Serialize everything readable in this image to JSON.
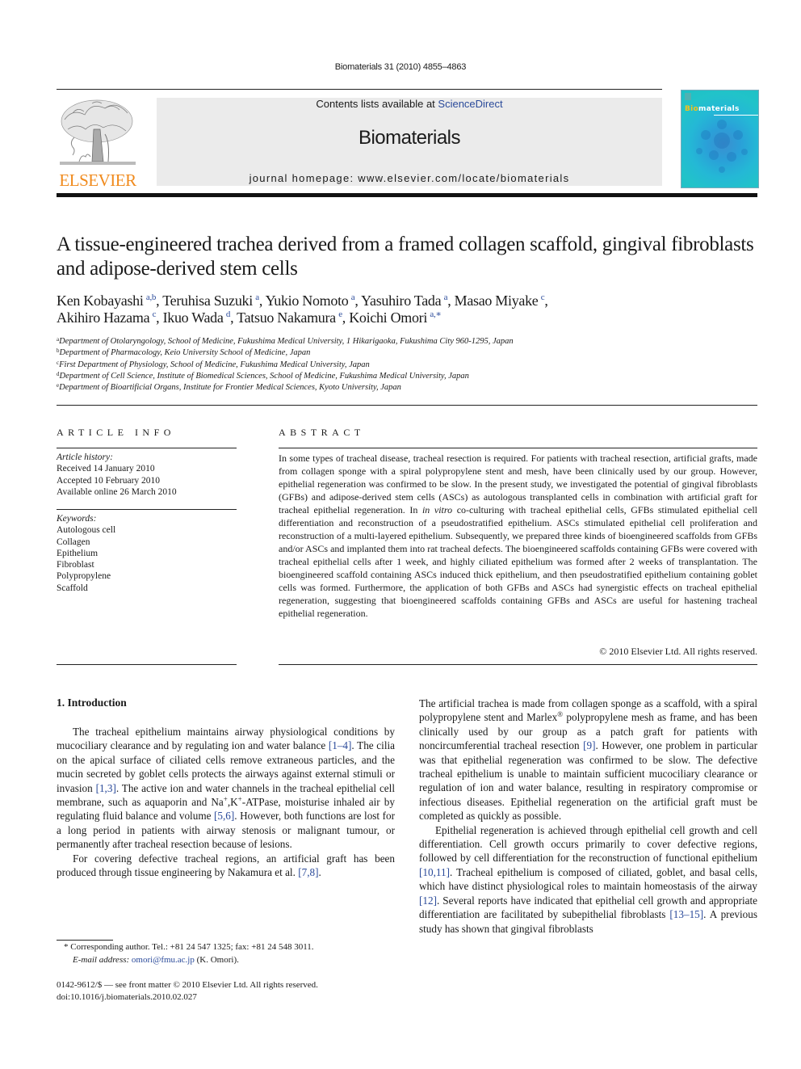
{
  "running_head": "Biomaterials 31 (2010) 4855–4863",
  "masthead": {
    "publisher_logo_text": "ELSEVIER",
    "contents_prefix": "Contents lists available at ",
    "contents_link": "ScienceDirect",
    "journal_name": "Biomaterials",
    "homepage": "journal homepage: www.elsevier.com/locate/biomaterials",
    "cover_title_bio": "Bio",
    "cover_title_rest": "materials",
    "colors": {
      "publisher_orange": "#f08a1c",
      "link_blue": "#2a4a9a",
      "masthead_bg": "#ebebeb",
      "cover_teal": "#21c3c9"
    }
  },
  "article": {
    "title": "A tissue-engineered trachea derived from a framed collagen scaffold, gingival fibroblasts and adipose-derived stem cells",
    "authors": [
      {
        "name": "Ken Kobayashi",
        "aff": "a,b",
        "sep": ", "
      },
      {
        "name": "Teruhisa Suzuki",
        "aff": "a",
        "sep": ", "
      },
      {
        "name": "Yukio Nomoto",
        "aff": "a",
        "sep": ", "
      },
      {
        "name": "Yasuhiro Tada",
        "aff": "a",
        "sep": ", "
      },
      {
        "name": "Masao Miyake",
        "aff": "c",
        "sep": ","
      },
      {
        "name": "Akihiro Hazama",
        "aff": "c",
        "sep": ", "
      },
      {
        "name": "Ikuo Wada",
        "aff": "d",
        "sep": ", "
      },
      {
        "name": "Tatsuo Nakamura",
        "aff": "e",
        "sep": ", "
      },
      {
        "name": "Koichi Omori",
        "aff": "a,∗",
        "sep": ""
      }
    ],
    "affiliations": [
      {
        "key": "a",
        "text": "Department of Otolaryngology, School of Medicine, Fukushima Medical University, 1 Hikarigaoka, Fukushima City 960-1295, Japan"
      },
      {
        "key": "b",
        "text": "Department of Pharmacology, Keio University School of Medicine, Japan"
      },
      {
        "key": "c",
        "text": "First Department of Physiology, School of Medicine, Fukushima Medical University, Japan"
      },
      {
        "key": "d",
        "text": "Department of Cell Science, Institute of Biomedical Sciences, School of Medicine, Fukushima Medical University, Japan"
      },
      {
        "key": "e",
        "text": "Department of Bioartificial Organs, Institute for Frontier Medical Sciences, Kyoto University, Japan"
      }
    ]
  },
  "article_info": {
    "heading": "ARTICLE INFO",
    "history_label": "Article history:",
    "history": [
      "Received 14 January 2010",
      "Accepted 10 February 2010",
      "Available online 26 March 2010"
    ],
    "keywords_label": "Keywords:",
    "keywords": [
      "Autologous cell",
      "Collagen",
      "Epithelium",
      "Fibroblast",
      "Polypropylene",
      "Scaffold"
    ]
  },
  "abstract": {
    "heading": "ABSTRACT",
    "text_1": "In some types of tracheal disease, tracheal resection is required. For patients with tracheal resection, artificial grafts, made from collagen sponge with a spiral polypropylene stent and mesh, have been clinically used by our group. However, epithelial regeneration was confirmed to be slow. In the present study, we investigated the potential of gingival fibroblasts (GFBs) and adipose-derived stem cells (ASCs) as autologous transplanted cells in combination with artificial graft for tracheal epithelial regeneration. In ",
    "text_italic": "in vitro",
    "text_2": " co-culturing with tracheal epithelial cells, GFBs stimulated epithelial cell differentiation and reconstruction of a pseudostratified epithelium. ASCs stimulated epithelial cell proliferation and reconstruction of a multi-layered epithelium. Subsequently, we prepared three kinds of bioengineered scaffolds from GFBs and/or ASCs and implanted them into rat tracheal defects. The bioengineered scaffolds containing GFBs were covered with tracheal epithelial cells after 1 week, and highly ciliated epithelium was formed after 2 weeks of transplantation. The bioengineered scaffold containing ASCs induced thick epithelium, and then pseudostratified epithelium containing goblet cells was formed. Furthermore, the application of both GFBs and ASCs had synergistic effects on tracheal epithelial regeneration, suggesting that bioengineered scaffolds containing GFBs and ASCs are useful for hastening tracheal epithelial regeneration.",
    "copyright": "© 2010 Elsevier Ltd. All rights reserved."
  },
  "introduction": {
    "heading": "1.  Introduction",
    "left_p1": [
      {
        "t": "The tracheal epithelium maintains airway physiological condi­tions by mucociliary clearance and by regulating ion and water balance "
      },
      {
        "ref": "[1–4]"
      },
      {
        "t": ". The cilia on the apical surface of ciliated cells remove extraneous particles, and the mucin secreted by goblet cells protects the airways against external stimuli or invasion "
      },
      {
        "ref": "[1,3]"
      },
      {
        "t": ". The active ion and water channels in the tracheal epithelial cell membrane, such as aquaporin and Na"
      },
      {
        "sup": "+"
      },
      {
        "t": ",K"
      },
      {
        "sup": "+"
      },
      {
        "t": "-ATPase, moisturise inhaled air by regulating fluid balance and volume "
      },
      {
        "ref": "[5,6]"
      },
      {
        "t": ". However, both functions are lost for a long period in patients with airway stenosis or malignant tumour, or permanently after tracheal resection because of lesions."
      }
    ],
    "left_p2": [
      {
        "t": "For covering defective tracheal regions, an artificial graft has been produced through tissue engineering by Nakamura et al. "
      },
      {
        "ref": "[7,8]"
      },
      {
        "t": "."
      }
    ],
    "right_p1": [
      {
        "t": "The artificial trachea is made from collagen sponge as a scaffold, with a spiral polypropylene stent and Marlex"
      },
      {
        "sup": "®"
      },
      {
        "t": " polypropylene mesh as frame, and has been clinically used by our group as a patch graft for patients with noncircumferential tracheal resection "
      },
      {
        "ref": "[9]"
      },
      {
        "t": ". However, one problem in particular was that epithelial regenera­tion was confirmed to be slow. The defective tracheal epithelium is unable to maintain sufficient mucociliary clearance or regulation of ion and water balance, resulting in respiratory compromise or infectious diseases. Epithelial regeneration on the artificial graft must be completed as quickly as possible."
      }
    ],
    "right_p2": [
      {
        "t": "Epithelial regeneration is achieved through epithelial cell growth and cell differentiation. Cell growth occurs primarily to cover defective regions, followed by cell differentiation for the reconstruction of functional epithelium "
      },
      {
        "ref": "[10,11]"
      },
      {
        "t": ". Tracheal epithe­lium is composed of ciliated, goblet, and basal cells, which have distinct physiological roles to maintain homeostasis of the airway "
      },
      {
        "ref": "[12]"
      },
      {
        "t": ". Several reports have indicated that epithelial cell growth and appropriate differentiation are facilitated by subepithelial fibro­blasts "
      },
      {
        "ref": "[13–15]"
      },
      {
        "t": ". A previous study has shown that gingival fibroblasts"
      }
    ]
  },
  "footnote": {
    "star": "*",
    "corresponding": " Corresponding author. Tel.: +81 24 547 1325; fax: +81 24 548 3011.",
    "email_label": "E-mail address:",
    "email": "omori@fmu.ac.jp",
    "email_suffix": " (K. Omori)."
  },
  "issn_line": "0142-9612/$ — see front matter © 2010 Elsevier Ltd. All rights reserved.",
  "doi_line": "doi:10.1016/j.biomaterials.2010.02.027"
}
